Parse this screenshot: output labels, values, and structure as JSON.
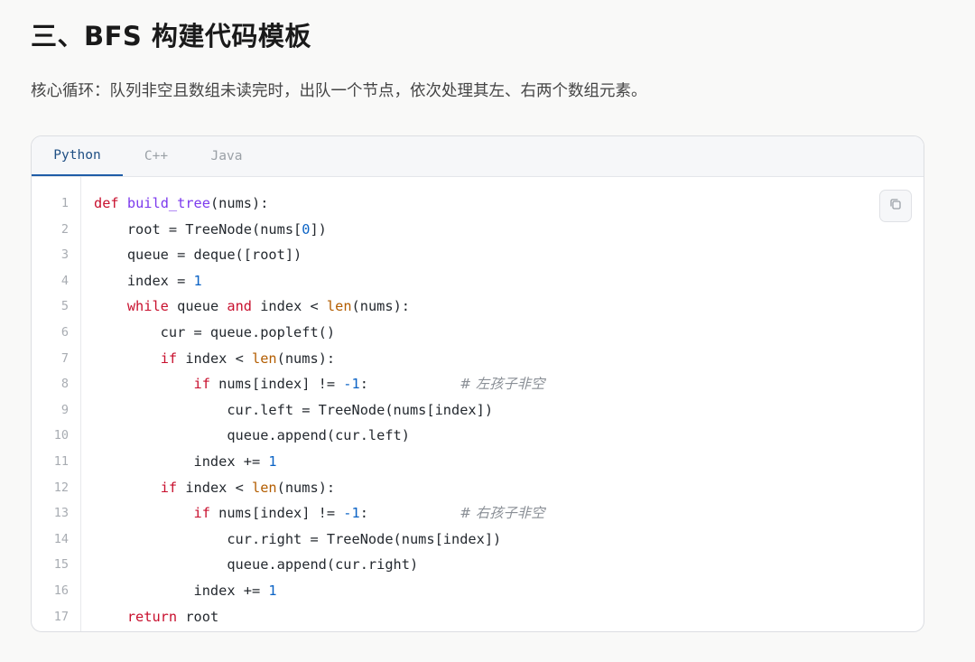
{
  "heading": "三、BFS 构建代码模板",
  "description": "核心循环：队列非空且数组未读完时，出队一个节点，依次处理其左、右两个数组元素。",
  "tabs": [
    {
      "label": "Python",
      "active": true
    },
    {
      "label": "C++",
      "active": false
    },
    {
      "label": "Java",
      "active": false
    }
  ],
  "code": {
    "language": "Python",
    "line_numbers": [
      "1",
      "2",
      "3",
      "4",
      "5",
      "6",
      "7",
      "8",
      "9",
      "10",
      "11",
      "12",
      "13",
      "14",
      "15",
      "16",
      "17"
    ],
    "lines": [
      "def build_tree(nums):",
      "    root = TreeNode(nums[0])",
      "    queue = deque([root])",
      "    index = 1",
      "    while queue and index < len(nums):",
      "        cur = queue.popleft()",
      "        if index < len(nums):",
      "            if nums[index] != -1:           # 左孩子非空",
      "                cur.left = TreeNode(nums[index])",
      "                queue.append(cur.left)",
      "            index += 1",
      "        if index < len(nums):",
      "            if nums[index] != -1:           # 右孩子非空",
      "                cur.right = TreeNode(nums[index])",
      "                queue.append(cur.right)",
      "            index += 1",
      "    return root"
    ]
  },
  "copy_button": {
    "icon": "copy-icon"
  },
  "colors": {
    "keyword": "#c8102e",
    "function": "#7c3aed",
    "builtin": "#b35d00",
    "number": "#0b63c5",
    "comment": "#8a8f96",
    "active_tab": "#1f5da8"
  }
}
